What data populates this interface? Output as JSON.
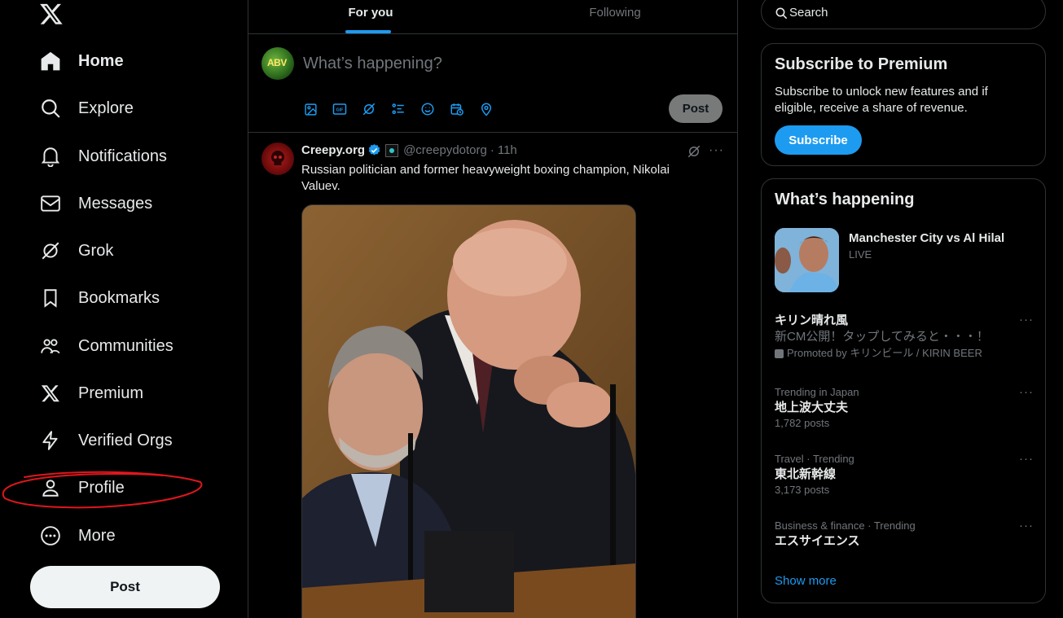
{
  "sidebar": {
    "logo": "x-logo-icon",
    "nav": [
      {
        "label": "Home",
        "icon": "home-icon"
      },
      {
        "label": "Explore",
        "icon": "search-icon"
      },
      {
        "label": "Notifications",
        "icon": "bell-icon"
      },
      {
        "label": "Messages",
        "icon": "envelope-icon"
      },
      {
        "label": "Grok",
        "icon": "grok-icon"
      },
      {
        "label": "Bookmarks",
        "icon": "bookmark-icon"
      },
      {
        "label": "Communities",
        "icon": "communities-icon"
      },
      {
        "label": "Premium",
        "icon": "x-logo-icon"
      },
      {
        "label": "Verified Orgs",
        "icon": "lightning-icon"
      },
      {
        "label": "Profile",
        "icon": "person-icon"
      },
      {
        "label": "More",
        "icon": "more-circle-icon"
      }
    ],
    "post_label": "Post"
  },
  "main": {
    "tabs": [
      {
        "label": "For you",
        "active": true
      },
      {
        "label": "Following",
        "active": false
      }
    ],
    "composer": {
      "avatar_text": "ABV",
      "placeholder": "What’s happening?",
      "tools": [
        "image-icon",
        "gif-icon",
        "grok-icon",
        "poll-icon",
        "emoji-icon",
        "schedule-icon",
        "location-icon"
      ],
      "post_label": "Post"
    },
    "tweet": {
      "name": "Creepy.org",
      "handle": "@creepydotorg",
      "separator": "·",
      "time": "11h",
      "text": "Russian politician and former heavyweight boxing champion, Nikolai Valuev.",
      "more": "···"
    }
  },
  "right": {
    "search_placeholder": "Search",
    "premium": {
      "title": "Subscribe to Premium",
      "description": "Subscribe to unlock new features and if eligible, receive a share of revenue.",
      "button": "Subscribe"
    },
    "happening": {
      "title": "What’s happening",
      "event": {
        "title": "Manchester City vs Al Hilal",
        "status": "LIVE"
      },
      "promoted": {
        "name": "キリン晴れ風",
        "desc": "新CM公開！タップしてみると・・・！",
        "promo": "Promoted by キリンビール / KIRIN BEER"
      },
      "trends": [
        {
          "meta": "Trending in Japan",
          "name": "地上波大丈夫",
          "count": "1,782 posts"
        },
        {
          "meta": "Travel · Trending",
          "name": "東北新幹線",
          "count": "3,173 posts"
        },
        {
          "meta": "Business & finance · Trending",
          "name": "エスサイエンス",
          "count": ""
        }
      ],
      "more": "···",
      "show_more": "Show more"
    }
  },
  "colors": {
    "accent": "#1d9bf0",
    "background": "#000000",
    "text": "#e7e9ea",
    "secondary_text": "#71767b",
    "border": "#2f3336",
    "annotation": "#e0161d"
  }
}
